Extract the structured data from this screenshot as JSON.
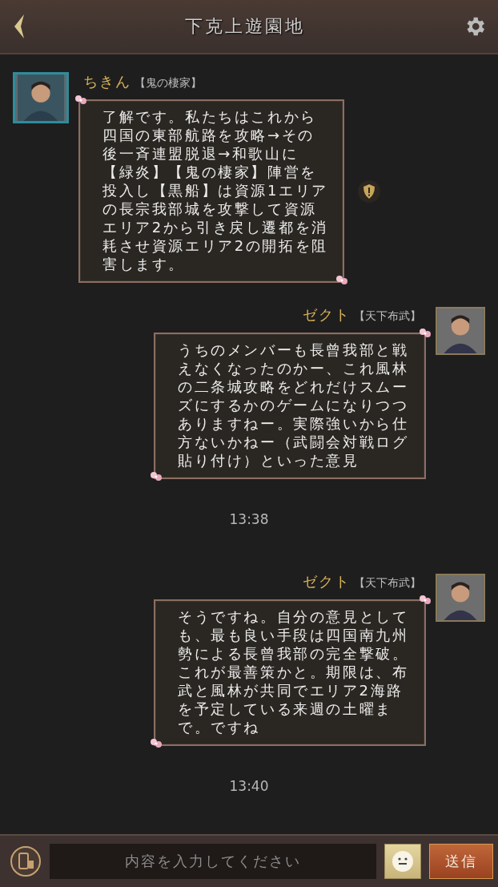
{
  "header": {
    "title": "下克上遊園地"
  },
  "messages": [
    {
      "kind": "received",
      "name": "ちきん",
      "group": "【鬼の棲家】",
      "text": "了解です。私たちはこれから四国の東部航路を攻略→その後一斉連盟脱退→和歌山に【緑炎】【鬼の棲家】陣営を投入し【黒船】は資源1エリアの長宗我部城を攻撃して資源エリア2から引き戻し遷都を消耗させ資源エリア2の開拓を阻害します。",
      "report": true
    },
    {
      "kind": "sent",
      "name": "ゼクト",
      "group": "【天下布武】",
      "text": "うちのメンバーも長曾我部と戦えなくなったのかー、これ風林の二条城攻略をどれだけスムーズにするかのゲームになりつつありますねー。実際強いから仕方ないかねー（武闘会対戦ログ貼り付け）といった意見",
      "report": false
    },
    {
      "kind": "time",
      "text": "13:38"
    },
    {
      "kind": "sent",
      "name": "ゼクト",
      "group": "【天下布武】",
      "text": "そうですね。自分の意見としても、最も良い手段は四国南九州勢による長曾我部の完全撃破。これが最善策かと。期限は、布武と風林が共同でエリア2海路を予定している来週の土曜まで。ですね",
      "report": false
    },
    {
      "kind": "time",
      "text": "13:40"
    }
  ],
  "composer": {
    "placeholder": "内容を入力してください",
    "send": "送信"
  }
}
